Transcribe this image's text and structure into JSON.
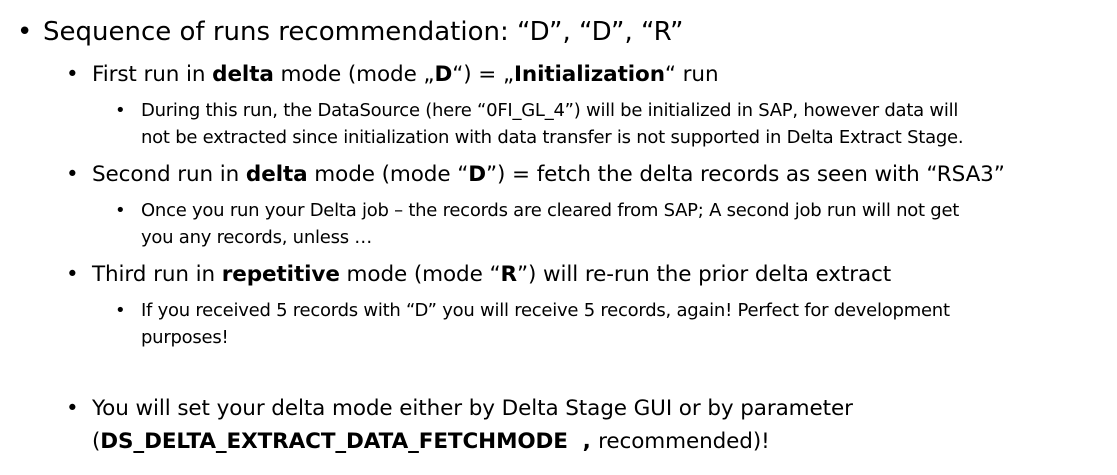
{
  "bullet_glyph": "•",
  "items": [
    {
      "level": 1,
      "runs": [
        {
          "t": "Sequence of runs recommendation: “D”, “D”, “R”",
          "b": false
        }
      ]
    },
    {
      "level": 2,
      "runs": [
        {
          "t": "First run in ",
          "b": false
        },
        {
          "t": "delta",
          "b": true
        },
        {
          "t": " mode (mode „",
          "b": false
        },
        {
          "t": "D",
          "b": true
        },
        {
          "t": "“) = „",
          "b": false
        },
        {
          "t": "Initialization",
          "b": true
        },
        {
          "t": "“ run",
          "b": false
        }
      ]
    },
    {
      "level": 3,
      "lines": [
        "During this run, the DataSource (here “0FI_GL_4”) will be initialized in SAP, however data will",
        "not be extracted since initialization with data transfer is not supported in Delta Extract Stage."
      ]
    },
    {
      "level": 2,
      "runs": [
        {
          "t": "Second run in ",
          "b": false
        },
        {
          "t": "delta",
          "b": true
        },
        {
          "t": " mode (mode “",
          "b": false
        },
        {
          "t": "D",
          "b": true
        },
        {
          "t": "”) = fetch the delta records as seen with “RSA3”",
          "b": false
        }
      ]
    },
    {
      "level": 3,
      "lines": [
        "Once you run your Delta job – the records are cleared from SAP; A second job run will not get",
        "you any records, unless …"
      ]
    },
    {
      "level": 2,
      "runs": [
        {
          "t": "Third run in ",
          "b": false
        },
        {
          "t": "repetitive",
          "b": true
        },
        {
          "t": " mode (mode “",
          "b": false
        },
        {
          "t": "R",
          "b": true
        },
        {
          "t": "”) will re-run the prior delta extract",
          "b": false
        }
      ]
    },
    {
      "level": 3,
      "lines": [
        "If you received 5 records with “D” you will receive 5 records, again! Perfect for development",
        "purposes!"
      ]
    },
    {
      "level": 2,
      "lines_runs": [
        [
          {
            "t": "You will set your delta mode either by Delta Stage GUI or by parameter",
            "b": false
          }
        ],
        [
          {
            "t": "(",
            "b": false
          },
          {
            "t": "DS_DELTA_EXTRACT_DATA_FETCHMODE",
            "b": true
          },
          {
            "t": "  , ",
            "b": false
          },
          {
            "t": "recommended)!",
            "b": false
          }
        ]
      ]
    }
  ]
}
